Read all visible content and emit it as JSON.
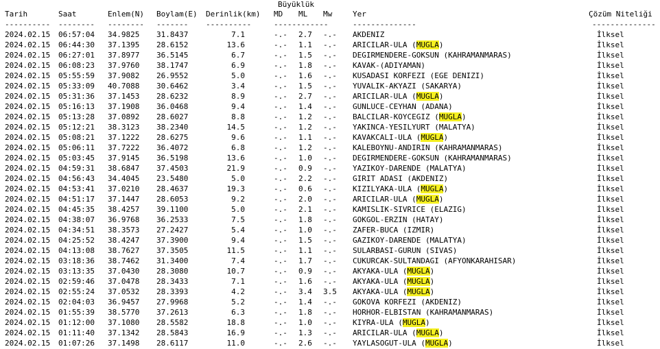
{
  "header": {
    "magnitude_group": "Büyüklük",
    "date": "Tarih",
    "time": "Saat",
    "lat": "Enlem(N)",
    "lon": "Boylam(E)",
    "depth": "Derinlik(km)",
    "md": "MD",
    "ml": "ML",
    "mw": "Mw",
    "place": "Yer",
    "quality": "Çözüm Niteliği"
  },
  "separators": {
    "date": "----------",
    "time": "--------",
    "lat": "--------",
    "lon": "-------",
    "depth": "----------",
    "mag": "------------",
    "place": "--------------",
    "quality": "--------------"
  },
  "highlight_color": "#f5f020",
  "rows": [
    {
      "date": "2024.02.15",
      "time": "06:57:04",
      "lat": "34.9825",
      "lon": "31.8437",
      "depth": "7.1",
      "md": "-.-",
      "ml": "2.7",
      "mw": "-.-",
      "place": "AKDENIZ",
      "hl": "",
      "after": "",
      "q": "İlksel"
    },
    {
      "date": "2024.02.15",
      "time": "06:44:30",
      "lat": "37.1395",
      "lon": "28.6152",
      "depth": "13.6",
      "md": "-.-",
      "ml": "1.1",
      "mw": "-.-",
      "place": "ARICILAR-ULA (",
      "hl": "MUGLA",
      "after": ")",
      "q": "İlksel"
    },
    {
      "date": "2024.02.15",
      "time": "06:27:01",
      "lat": "37.8977",
      "lon": "36.5145",
      "depth": "6.7",
      "md": "-.-",
      "ml": "1.5",
      "mw": "-.-",
      "place": "DEGIRMENDERE-GOKSUN (KAHRAMANMARAS)",
      "hl": "",
      "after": "",
      "q": "İlksel"
    },
    {
      "date": "2024.02.15",
      "time": "06:08:23",
      "lat": "37.9760",
      "lon": "38.1747",
      "depth": "6.9",
      "md": "-.-",
      "ml": "1.8",
      "mw": "-.-",
      "place": "KAVAK-(ADIYAMAN)",
      "hl": "",
      "after": "",
      "q": "İlksel"
    },
    {
      "date": "2024.02.15",
      "time": "05:55:59",
      "lat": "37.9082",
      "lon": "26.9552",
      "depth": "5.0",
      "md": "-.-",
      "ml": "1.6",
      "mw": "-.-",
      "place": "KUSADASI KORFEZI (EGE DENIZI)",
      "hl": "",
      "after": "",
      "q": "İlksel"
    },
    {
      "date": "2024.02.15",
      "time": "05:33:09",
      "lat": "40.7088",
      "lon": "30.6462",
      "depth": "3.4",
      "md": "-.-",
      "ml": "1.5",
      "mw": "-.-",
      "place": "YUVALIK-AKYAZI (SAKARYA)",
      "hl": "",
      "after": "",
      "q": "İlksel"
    },
    {
      "date": "2024.02.15",
      "time": "05:31:36",
      "lat": "37.1453",
      "lon": "28.6232",
      "depth": "8.9",
      "md": "-.-",
      "ml": "2.7",
      "mw": "-.-",
      "place": "ARICILAR-ULA (",
      "hl": "MUGLA",
      "after": ")",
      "q": "İlksel"
    },
    {
      "date": "2024.02.15",
      "time": "05:16:13",
      "lat": "37.1908",
      "lon": "36.0468",
      "depth": "9.4",
      "md": "-.-",
      "ml": "1.4",
      "mw": "-.-",
      "place": "GUNLUCE-CEYHAN (ADANA)",
      "hl": "",
      "after": "",
      "q": "İlksel"
    },
    {
      "date": "2024.02.15",
      "time": "05:13:28",
      "lat": "37.0892",
      "lon": "28.6027",
      "depth": "8.8",
      "md": "-.-",
      "ml": "1.2",
      "mw": "-.-",
      "place": "BALCILAR-KOYCEGIZ (",
      "hl": "MUGLA",
      "after": ")",
      "q": "İlksel"
    },
    {
      "date": "2024.02.15",
      "time": "05:12:21",
      "lat": "38.3123",
      "lon": "38.2340",
      "depth": "14.5",
      "md": "-.-",
      "ml": "1.2",
      "mw": "-.-",
      "place": "YAKINCA-YESILYURT (MALATYA)",
      "hl": "",
      "after": "",
      "q": "İlksel"
    },
    {
      "date": "2024.02.15",
      "time": "05:08:21",
      "lat": "37.1222",
      "lon": "28.6275",
      "depth": "9.6",
      "md": "-.-",
      "ml": "1.1",
      "mw": "-.-",
      "place": "KAVAKCALI-ULA (",
      "hl": "MUGLA",
      "after": ")",
      "q": "İlksel"
    },
    {
      "date": "2024.02.15",
      "time": "05:06:11",
      "lat": "37.7222",
      "lon": "36.4072",
      "depth": "6.8",
      "md": "-.-",
      "ml": "1.2",
      "mw": "-.-",
      "place": "KALEBOYNU-ANDIRIN (KAHRAMANMARAS)",
      "hl": "",
      "after": "",
      "q": "İlksel"
    },
    {
      "date": "2024.02.15",
      "time": "05:03:45",
      "lat": "37.9145",
      "lon": "36.5198",
      "depth": "13.6",
      "md": "-.-",
      "ml": "1.0",
      "mw": "-.-",
      "place": "DEGIRMENDERE-GOKSUN (KAHRAMANMARAS)",
      "hl": "",
      "after": "",
      "q": "İlksel"
    },
    {
      "date": "2024.02.15",
      "time": "04:59:31",
      "lat": "38.6847",
      "lon": "37.4503",
      "depth": "21.9",
      "md": "-.-",
      "ml": "0.9",
      "mw": "-.-",
      "place": "YAZIKOY-DARENDE (MALATYA)",
      "hl": "",
      "after": "",
      "q": "İlksel"
    },
    {
      "date": "2024.02.15",
      "time": "04:56:43",
      "lat": "34.4045",
      "lon": "23.5480",
      "depth": "5.0",
      "md": "-.-",
      "ml": "2.2",
      "mw": "-.-",
      "place": "GIRIT ADASI (AKDENIZ)",
      "hl": "",
      "after": "",
      "q": "İlksel"
    },
    {
      "date": "2024.02.15",
      "time": "04:53:41",
      "lat": "37.0210",
      "lon": "28.4637",
      "depth": "19.3",
      "md": "-.-",
      "ml": "0.6",
      "mw": "-.-",
      "place": "KIZILYAKA-ULA (",
      "hl": "MUGLA",
      "after": ")",
      "q": "İlksel"
    },
    {
      "date": "2024.02.15",
      "time": "04:51:17",
      "lat": "37.1447",
      "lon": "28.6053",
      "depth": "9.2",
      "md": "-.-",
      "ml": "2.0",
      "mw": "-.-",
      "place": "ARICILAR-ULA (",
      "hl": "MUGLA",
      "after": ")",
      "q": "İlksel"
    },
    {
      "date": "2024.02.15",
      "time": "04:45:35",
      "lat": "38.4257",
      "lon": "39.1100",
      "depth": "5.0",
      "md": "-.-",
      "ml": "2.1",
      "mw": "-.-",
      "place": "KAMISLIK-SIVRICE (ELAZIG)",
      "hl": "",
      "after": "",
      "q": "İlksel"
    },
    {
      "date": "2024.02.15",
      "time": "04:38:07",
      "lat": "36.9768",
      "lon": "36.2533",
      "depth": "7.5",
      "md": "-.-",
      "ml": "1.8",
      "mw": "-.-",
      "place": "GOKGOL-ERZIN (HATAY)",
      "hl": "",
      "after": "",
      "q": "İlksel"
    },
    {
      "date": "2024.02.15",
      "time": "04:34:51",
      "lat": "38.3573",
      "lon": "27.2427",
      "depth": "5.4",
      "md": "-.-",
      "ml": "1.0",
      "mw": "-.-",
      "place": "ZAFER-BUCA (IZMIR)",
      "hl": "",
      "after": "",
      "q": "İlksel"
    },
    {
      "date": "2024.02.15",
      "time": "04:25:52",
      "lat": "38.4247",
      "lon": "37.3900",
      "depth": "9.4",
      "md": "-.-",
      "ml": "1.5",
      "mw": "-.-",
      "place": "GAZIKOY-DARENDE (MALATYA)",
      "hl": "",
      "after": "",
      "q": "İlksel"
    },
    {
      "date": "2024.02.15",
      "time": "04:13:08",
      "lat": "38.7627",
      "lon": "37.3505",
      "depth": "11.5",
      "md": "-.-",
      "ml": "1.1",
      "mw": "-.-",
      "place": "SULARBASI-GURUN (SIVAS)",
      "hl": "",
      "after": "",
      "q": "İlksel"
    },
    {
      "date": "2024.02.15",
      "time": "03:18:36",
      "lat": "38.7462",
      "lon": "31.3400",
      "depth": "7.4",
      "md": "-.-",
      "ml": "1.7",
      "mw": "-.-",
      "place": "CUKURCAK-SULTANDAGI (AFYONKARAHISAR)",
      "hl": "",
      "after": "",
      "q": "İlksel"
    },
    {
      "date": "2024.02.15",
      "time": "03:13:35",
      "lat": "37.0430",
      "lon": "28.3080",
      "depth": "10.7",
      "md": "-.-",
      "ml": "0.9",
      "mw": "-.-",
      "place": "AKYAKA-ULA (",
      "hl": "MUGLA",
      "after": ")",
      "q": "İlksel"
    },
    {
      "date": "2024.02.15",
      "time": "02:59:46",
      "lat": "37.0478",
      "lon": "28.3433",
      "depth": "7.1",
      "md": "-.-",
      "ml": "1.6",
      "mw": "-.-",
      "place": "AKYAKA-ULA (",
      "hl": "MUGLA",
      "after": ")",
      "q": "İlksel"
    },
    {
      "date": "2024.02.15",
      "time": "02:55:24",
      "lat": "37.0532",
      "lon": "28.3393",
      "depth": "4.2",
      "md": "-.-",
      "ml": "3.4",
      "mw": "3.5",
      "place": "AKYAKA-ULA (",
      "hl": "MUGLA",
      "after": ")",
      "q": "İlksel"
    },
    {
      "date": "2024.02.15",
      "time": "02:04:03",
      "lat": "36.9457",
      "lon": "27.9968",
      "depth": "5.2",
      "md": "-.-",
      "ml": "1.4",
      "mw": "-.-",
      "place": "GOKOVA KORFEZI (AKDENIZ)",
      "hl": "",
      "after": "",
      "q": "İlksel"
    },
    {
      "date": "2024.02.15",
      "time": "01:55:39",
      "lat": "38.5770",
      "lon": "37.2613",
      "depth": "6.3",
      "md": "-.-",
      "ml": "1.8",
      "mw": "-.-",
      "place": "HORHOR-ELBISTAN (KAHRAMANMARAS)",
      "hl": "",
      "after": "",
      "q": "İlksel"
    },
    {
      "date": "2024.02.15",
      "time": "01:12:00",
      "lat": "37.1080",
      "lon": "28.5582",
      "depth": "18.8",
      "md": "-.-",
      "ml": "1.0",
      "mw": "-.-",
      "place": "KIYRA-ULA (",
      "hl": "MUGLA",
      "after": ")",
      "q": "İlksel"
    },
    {
      "date": "2024.02.15",
      "time": "01:11:40",
      "lat": "37.1342",
      "lon": "28.5843",
      "depth": "16.9",
      "md": "-.-",
      "ml": "1.3",
      "mw": "-.-",
      "place": "ARICILAR-ULA (",
      "hl": "MUGLA",
      "after": ")",
      "q": "İlksel"
    },
    {
      "date": "2024.02.15",
      "time": "01:07:26",
      "lat": "37.1498",
      "lon": "28.6117",
      "depth": "11.0",
      "md": "-.-",
      "ml": "2.6",
      "mw": "-.-",
      "place": "YAYLASOGUT-ULA (",
      "hl": "MUGLA",
      "after": ")",
      "q": "İlksel"
    }
  ]
}
